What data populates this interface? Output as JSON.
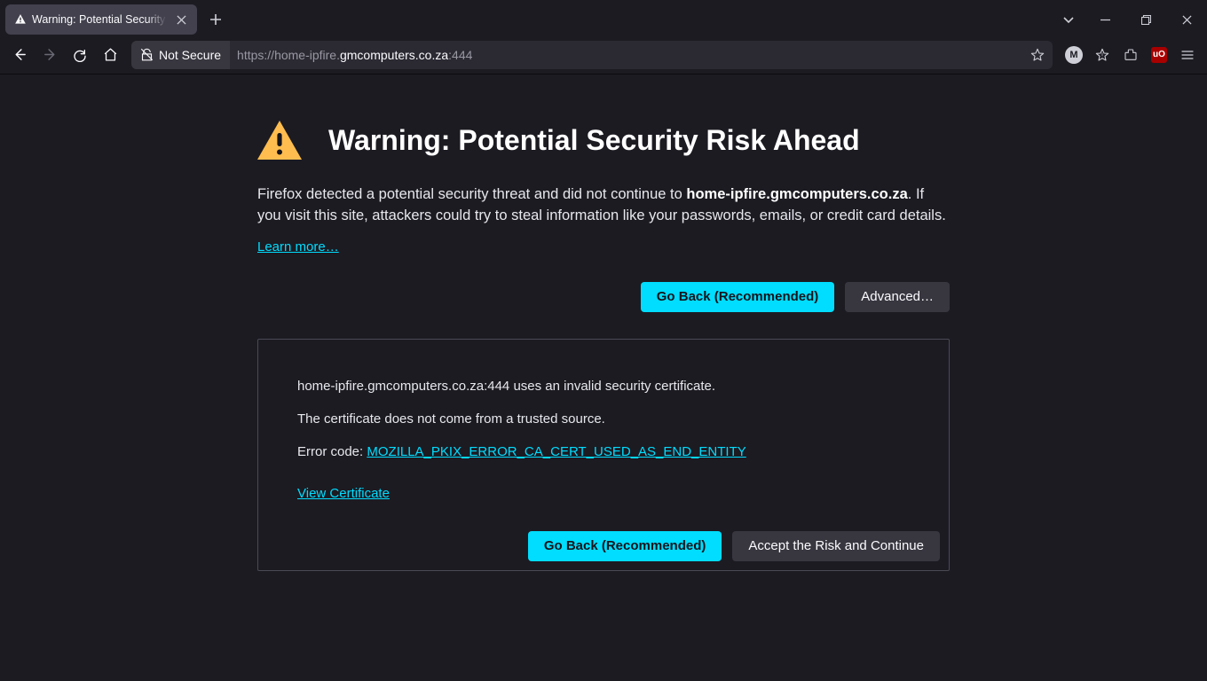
{
  "tab": {
    "title": "Warning: Potential Security Risk Ahead",
    "icon": "warning-triangle-white-icon"
  },
  "addressbar": {
    "identity_label": "Not Secure",
    "url_prefix": "https://home-ipfire.",
    "url_host": "gmcomputers.co.za",
    "url_suffix": ":444"
  },
  "account_letter": "M",
  "ublock_label": "uO",
  "page": {
    "title": "Warning: Potential Security Risk Ahead",
    "para1_a": "Firefox detected a potential security threat and did not continue to ",
    "para1_host": "home-ipfire.gmcomputers.co.za",
    "para1_b": ". If you visit this site, attackers could try to steal information like your passwords, emails, or credit card details.",
    "learn_more": "Learn more…",
    "go_back": "Go Back (Recommended)",
    "advanced": "Advanced…",
    "panel": {
      "line1": "home-ipfire.gmcomputers.co.za:444 uses an invalid security certificate.",
      "line2": "The certificate does not come from a trusted source.",
      "error_label": "Error code: ",
      "error_code": "MOZILLA_PKIX_ERROR_CA_CERT_USED_AS_END_ENTITY",
      "view_cert": "View Certificate",
      "go_back": "Go Back (Recommended)",
      "accept": "Accept the Risk and Continue"
    }
  }
}
